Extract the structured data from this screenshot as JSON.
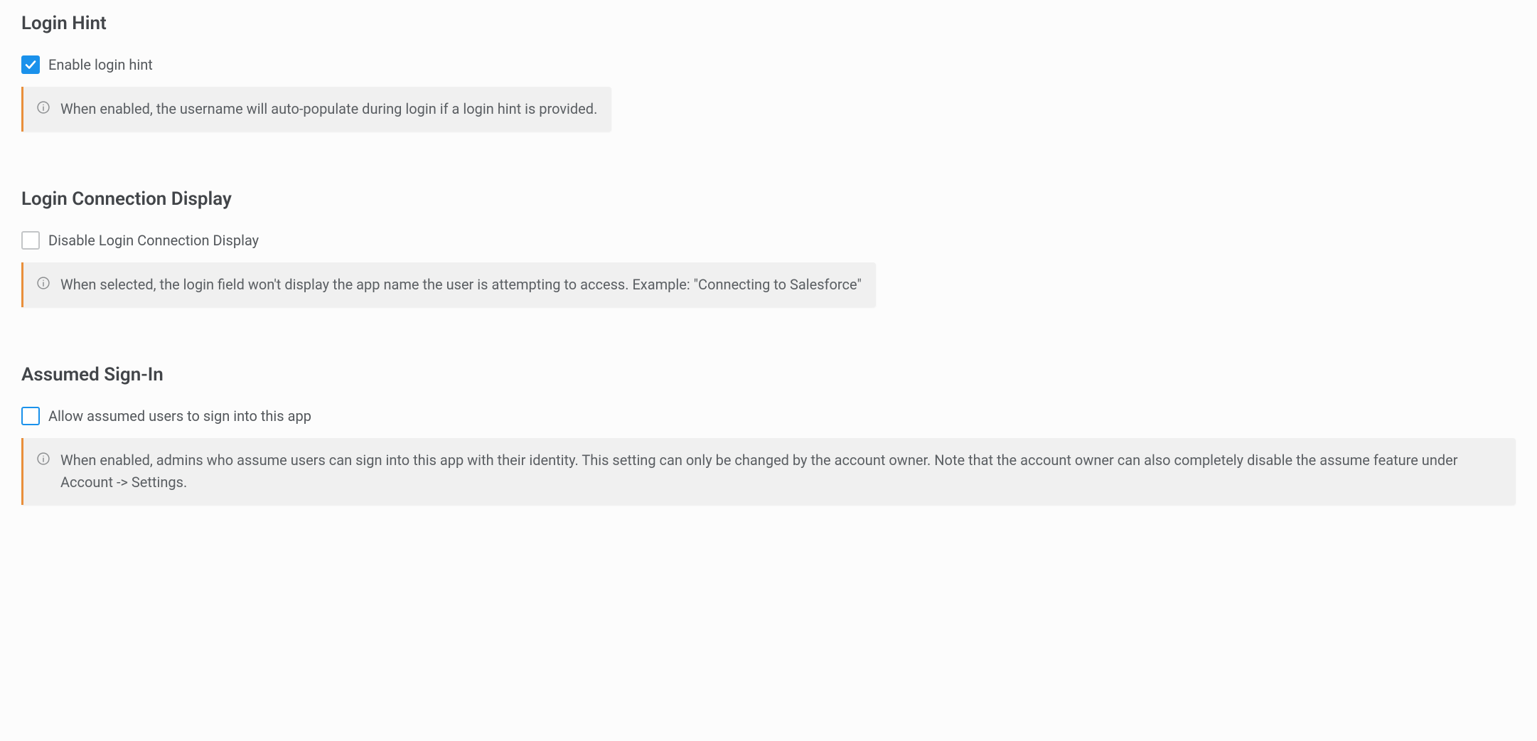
{
  "sections": {
    "loginHint": {
      "title": "Login Hint",
      "checkboxLabel": "Enable login hint",
      "checked": true,
      "info": "When enabled, the username will auto-populate during login if a login hint is provided."
    },
    "loginConnection": {
      "title": "Login Connection Display",
      "checkboxLabel": "Disable Login Connection Display",
      "checked": false,
      "info": "When selected, the login field won't display the app name the user is attempting to access. Example: \"Connecting to Salesforce\""
    },
    "assumedSignIn": {
      "title": "Assumed Sign-In",
      "checkboxLabel": "Allow assumed users to sign into this app",
      "checked": false,
      "info": "When enabled, admins who assume users can sign into this app with their identity. This setting can only be changed by the account owner. Note that the account owner can also completely disable the assume feature under Account -> Settings."
    }
  }
}
